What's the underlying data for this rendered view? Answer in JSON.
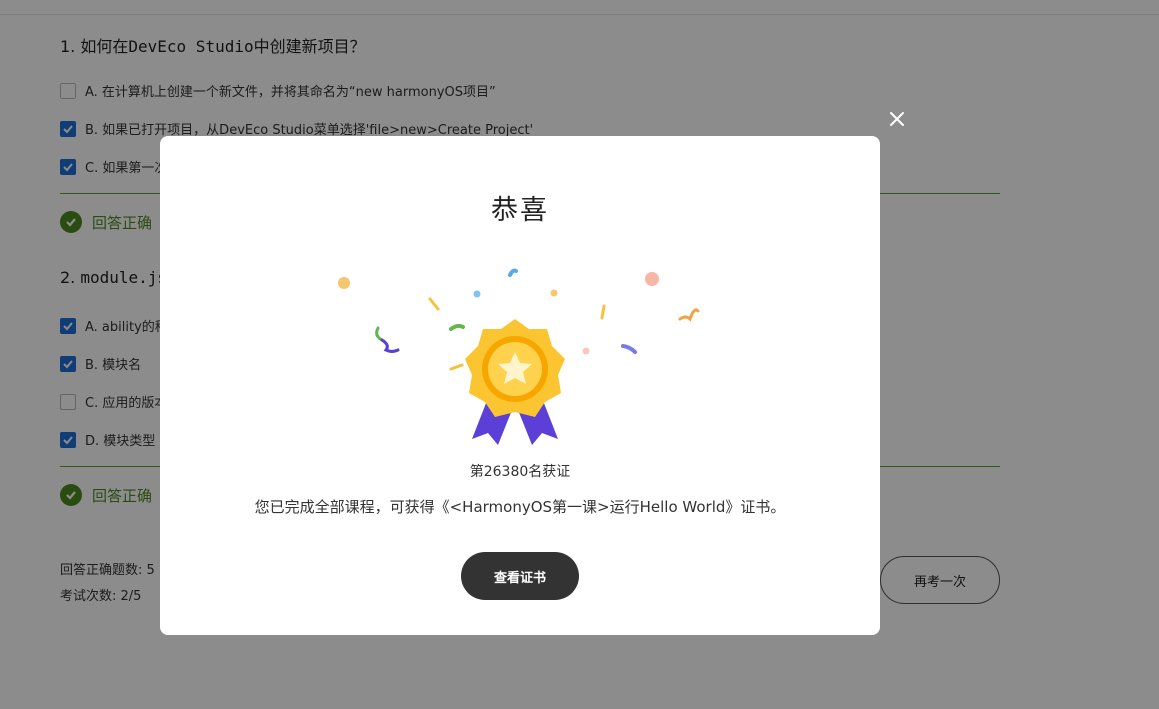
{
  "quiz": {
    "q1": {
      "number": "1.",
      "title_prefix": "如何在",
      "title_mono": "DevEco Studio",
      "title_suffix": "中创建新项目？",
      "options": [
        {
          "label": "A. 在计算机上创建一个新文件，并将其命名为“new harmonyOS项目”",
          "checked": false
        },
        {
          "label": "B. 如果已打开项目，从DevEco Studio菜单选择'file>new>Create Project'",
          "checked": true
        },
        {
          "label": "C. 如果第一次",
          "checked": true
        }
      ],
      "result": "回答正确"
    },
    "q2": {
      "number": "2.",
      "title_mono": "module.jso",
      "options": [
        {
          "label": "A. ability的种",
          "checked": true
        },
        {
          "label": "B. 模块名",
          "checked": true
        },
        {
          "label": "C. 应用的版本",
          "checked": false
        },
        {
          "label": "D. 模块类型",
          "checked": true
        }
      ],
      "result": "回答正确"
    },
    "stats": {
      "correct_count": "回答正确题数: 5",
      "attempts": "考试次数: 2/5"
    },
    "retry_label": "再考一次"
  },
  "modal": {
    "title": "恭喜",
    "rank": "第26380名获证",
    "description": "您已完成全部课程，可获得《<HarmonyOS第一课>运行Hello World》证书。",
    "button_label": "查看证书"
  },
  "colors": {
    "accent_green": "#4d8a1e",
    "checkbox_blue": "#1e6fd6",
    "button_dark": "#333333",
    "medal_gold": "#f7b500",
    "ribbon_purple": "#5b3fd6"
  }
}
